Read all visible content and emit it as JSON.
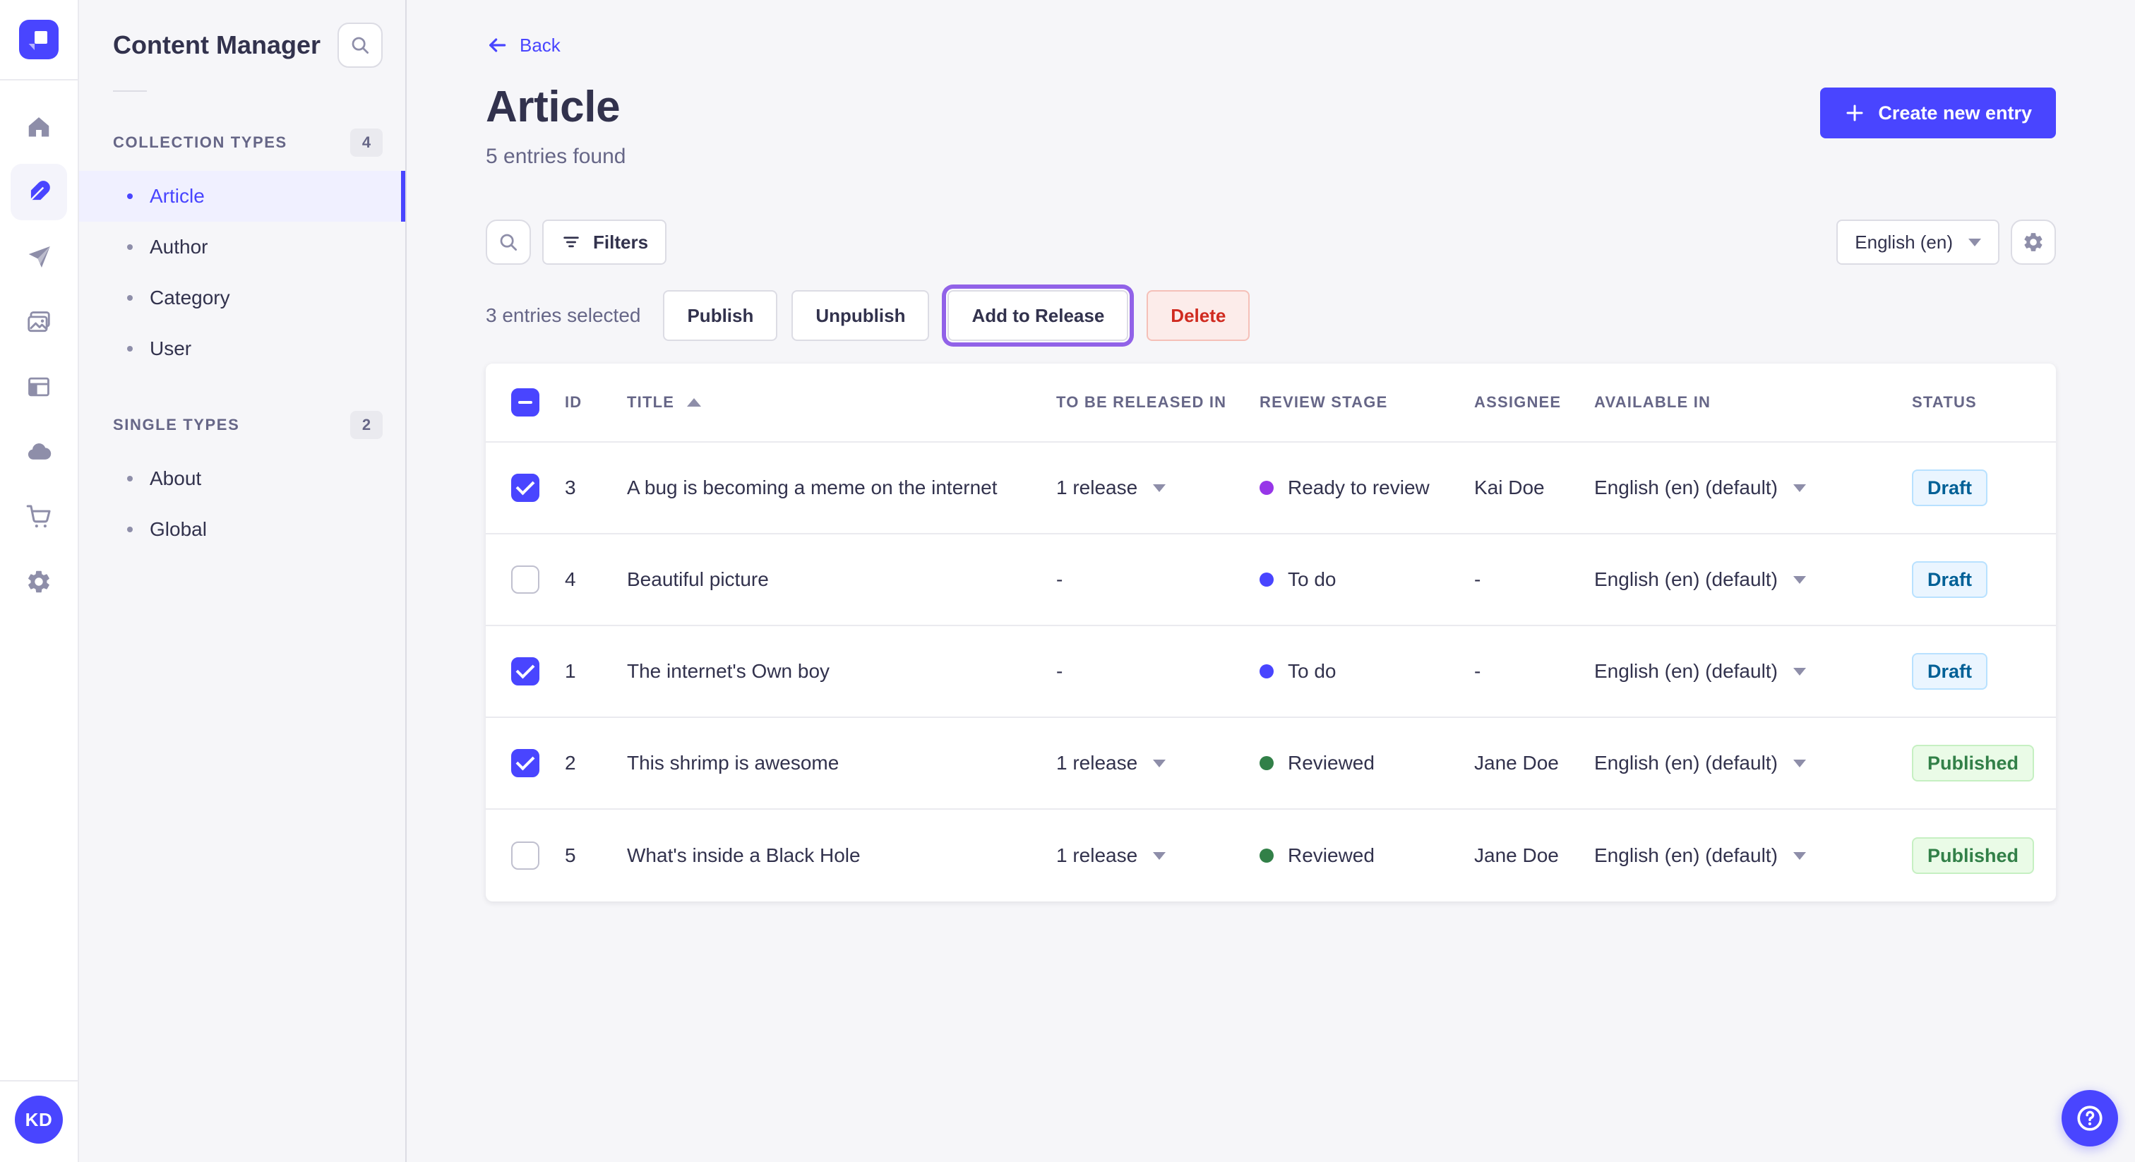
{
  "subnav": {
    "title": "Content Manager",
    "sections": [
      {
        "label": "COLLECTION TYPES",
        "count": "4",
        "items": [
          {
            "label": "Article",
            "active": true
          },
          {
            "label": "Author",
            "active": false
          },
          {
            "label": "Category",
            "active": false
          },
          {
            "label": "User",
            "active": false
          }
        ]
      },
      {
        "label": "SINGLE TYPES",
        "count": "2",
        "items": [
          {
            "label": "About",
            "active": false
          },
          {
            "label": "Global",
            "active": false
          }
        ]
      }
    ]
  },
  "header": {
    "back_label": "Back",
    "title": "Article",
    "subtitle": "5 entries found",
    "create_label": "Create new entry"
  },
  "toolbar": {
    "filters_label": "Filters",
    "locale_value": "English (en)"
  },
  "bulk": {
    "selected_label": "3 entries selected",
    "publish_label": "Publish",
    "unpublish_label": "Unpublish",
    "add_to_release_label": "Add to Release",
    "delete_label": "Delete"
  },
  "table": {
    "columns": {
      "id": "ID",
      "title": "TITLE",
      "release": "TO BE RELEASED IN",
      "stage": "REVIEW STAGE",
      "assignee": "ASSIGNEE",
      "available": "AVAILABLE IN",
      "status": "STATUS"
    },
    "rows": [
      {
        "checked": true,
        "id": "3",
        "title": "A bug is becoming a meme on the internet",
        "release": "1 release",
        "stage": "Ready to review",
        "stage_color": "#9736e8",
        "assignee": "Kai Doe",
        "available": "English (en) (default)",
        "status": "Draft"
      },
      {
        "checked": false,
        "id": "4",
        "title": "Beautiful picture",
        "release": "-",
        "stage": "To do",
        "stage_color": "#4945ff",
        "assignee": "-",
        "available": "English (en) (default)",
        "status": "Draft"
      },
      {
        "checked": true,
        "id": "1",
        "title": "The internet's Own boy",
        "release": "-",
        "stage": "To do",
        "stage_color": "#4945ff",
        "assignee": "-",
        "available": "English (en) (default)",
        "status": "Draft"
      },
      {
        "checked": true,
        "id": "2",
        "title": "This shrimp is awesome",
        "release": "1 release",
        "stage": "Reviewed",
        "stage_color": "#328048",
        "assignee": "Jane Doe",
        "available": "English (en) (default)",
        "status": "Published"
      },
      {
        "checked": false,
        "id": "5",
        "title": "What's inside a Black Hole",
        "release": "1 release",
        "stage": "Reviewed",
        "stage_color": "#328048",
        "assignee": "Jane Doe",
        "available": "English (en) (default)",
        "status": "Published"
      }
    ]
  },
  "user": {
    "initials": "KD"
  },
  "colors": {
    "primary": "#4945ff",
    "release_ring": "#9162e8",
    "draft_text": "#006096",
    "published_text": "#328048",
    "delete_text": "#d02b20",
    "stage_purple": "#9736e8",
    "stage_blue": "#4945ff",
    "stage_green": "#328048"
  }
}
